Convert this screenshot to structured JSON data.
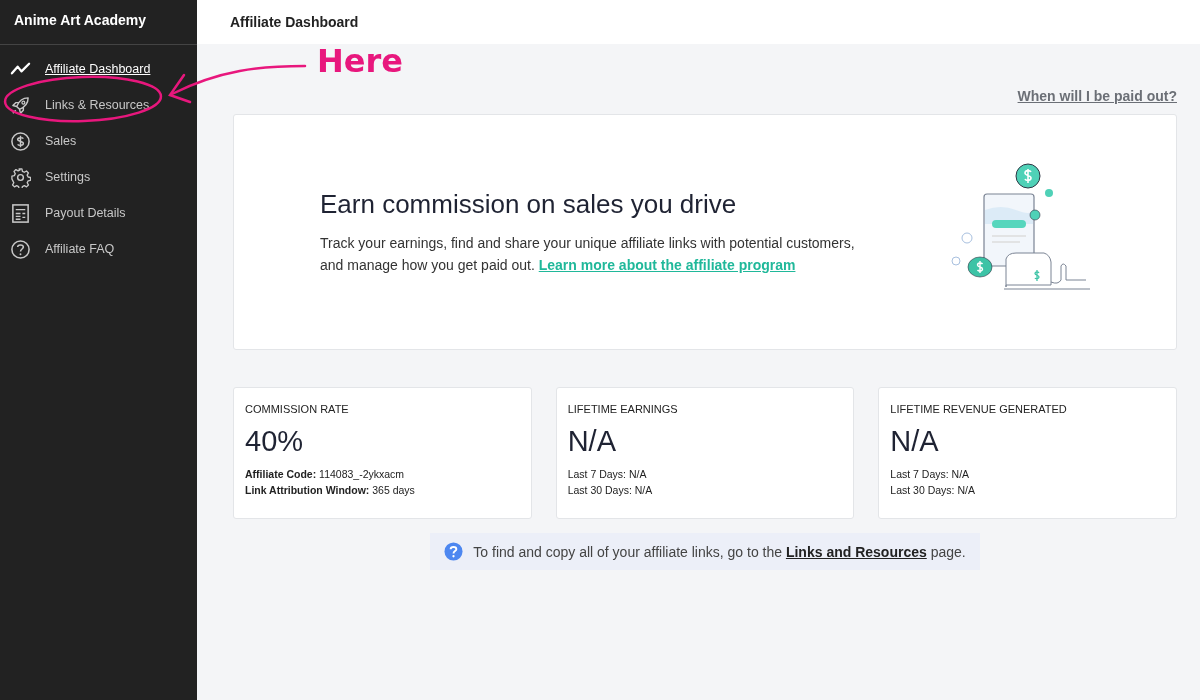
{
  "sidebar": {
    "brand": "Anime Art Academy",
    "items": [
      {
        "label": "Affiliate Dashboard",
        "selected": true
      },
      {
        "label": "Links & Resources",
        "selected": false
      },
      {
        "label": "Sales",
        "selected": false
      },
      {
        "label": "Settings",
        "selected": false
      },
      {
        "label": "Payout Details",
        "selected": false
      },
      {
        "label": "Affiliate FAQ",
        "selected": false
      }
    ]
  },
  "header": {
    "title": "Affiliate Dashboard"
  },
  "payout_link": "When will I be paid out?",
  "hero": {
    "title": "Earn commission on sales you drive",
    "text": "Track your earnings, find and share your unique affiliate links with potential customers, and manage how you get paid out.",
    "link": "Learn more about the affiliate program"
  },
  "stats": [
    {
      "label": "COMMISSION RATE",
      "value": "40%",
      "details": [
        "**Affiliate Code:** 114083_-2ykxacm",
        "**Link Attribution Window:** 365 days"
      ]
    },
    {
      "label": "LIFETIME EARNINGS",
      "value": "N/A",
      "details": [
        "Last 7 Days: N/A",
        "Last 30 Days: N/A"
      ]
    },
    {
      "label": "LIFETIME REVENUE GENERATED",
      "value": "N/A",
      "details": [
        "Last 7 Days: N/A",
        "Last 30 Days: N/A"
      ]
    }
  ],
  "info": {
    "text": "To find and copy all of your affiliate links, go to the",
    "link": "Links and Resources",
    "after": "page."
  },
  "annotation": {
    "text": "Here"
  }
}
